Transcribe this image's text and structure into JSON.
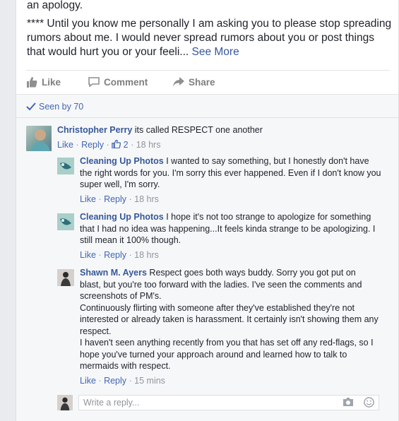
{
  "post": {
    "line0": "an apology.",
    "body": "**** Until you know me personally I am asking you to please stop spreading rumors about me. I would never spread rumors about you or post things that would hurt you or your feeli...",
    "see_more": "See More"
  },
  "actions": {
    "like": "Like",
    "comment": "Comment",
    "share": "Share"
  },
  "seen": "Seen by 70",
  "comments": [
    {
      "author": "Christopher Perry",
      "text": "its called RESPECT one another",
      "like": "Like",
      "reply": "Reply",
      "reactions": "2",
      "time": "18 hrs"
    },
    {
      "author": "Cleaning Up Photos",
      "text": "I wanted to say something, but I honestly don't have the right words for you. I'm sorry this ever happened. Even if I don't know you super well, I'm sorry.",
      "like": "Like",
      "reply": "Reply",
      "time": "18 hrs"
    },
    {
      "author": "Cleaning Up Photos",
      "text": "I hope it's not too strange to apologize for something that I had no idea was happening...It feels kinda strange to be apologizing. I still mean it 100% though.",
      "like": "Like",
      "reply": "Reply",
      "time": "18 hrs"
    },
    {
      "author": "Shawn M. Ayers",
      "text": "Respect goes both ways buddy. Sorry you got put on blast, but you're too forward with the ladies. I've seen the comments and screenshots of PM's.",
      "text2": "Continuously flirting with someone after they've established they're not interested or already taken is harassment. It certainly isn't showing them any respect.",
      "text3": "I haven't seen anything recently from you that has set off any red-flags, so I hope you've turned your approach around and learned how to talk to mermaids with respect.",
      "like": "Like",
      "reply": "Reply",
      "time": "15 mins"
    }
  ],
  "reply_box": {
    "placeholder": "Write a reply..."
  },
  "colors": {
    "link": "#365899",
    "meta_link": "#4267b2",
    "muted": "#90949c"
  }
}
